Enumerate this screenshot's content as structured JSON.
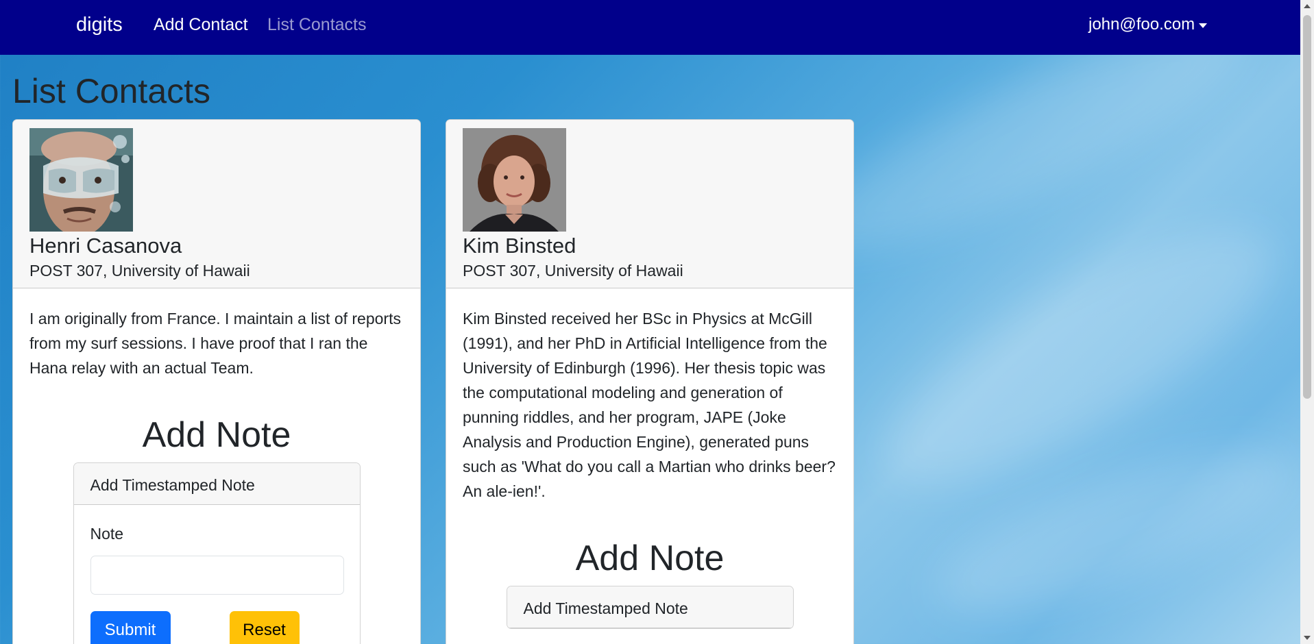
{
  "navbar": {
    "brand": "digits",
    "links": [
      {
        "label": "Add Contact"
      },
      {
        "label": "List Contacts"
      }
    ],
    "user": "john@foo.com",
    "background": "#01008b"
  },
  "page": {
    "title": "List Contacts"
  },
  "contacts": [
    {
      "name": "Henri Casanova",
      "address": "POST 307, University of Hawaii",
      "description": "I am originally from France. I maintain a list of reports from my surf sessions. I have proof that I ran the Hana relay with an actual Team.",
      "note_form": {
        "heading": "Add Note",
        "card_title": "Add Timestamped Note",
        "field_label": "Note",
        "field_value": "",
        "submit_label": "Submit",
        "reset_label": "Reset"
      }
    },
    {
      "name": "Kim Binsted",
      "address": "POST 307, University of Hawaii",
      "description": "Kim Binsted received her BSc in Physics at McGill (1991), and her PhD in Artificial Intelligence from the University of Edinburgh (1996). Her thesis topic was the computational modeling and generation of punning riddles, and her program, JAPE (Joke Analysis and Production Engine), generated puns such as 'What do you call a Martian who drinks beer? An ale-ien!'.",
      "note_form": {
        "heading": "Add Note",
        "card_title": "Add Timestamped Note"
      }
    }
  ],
  "colors": {
    "primary_button": "#0d6efd",
    "warning_button": "#ffc107"
  }
}
